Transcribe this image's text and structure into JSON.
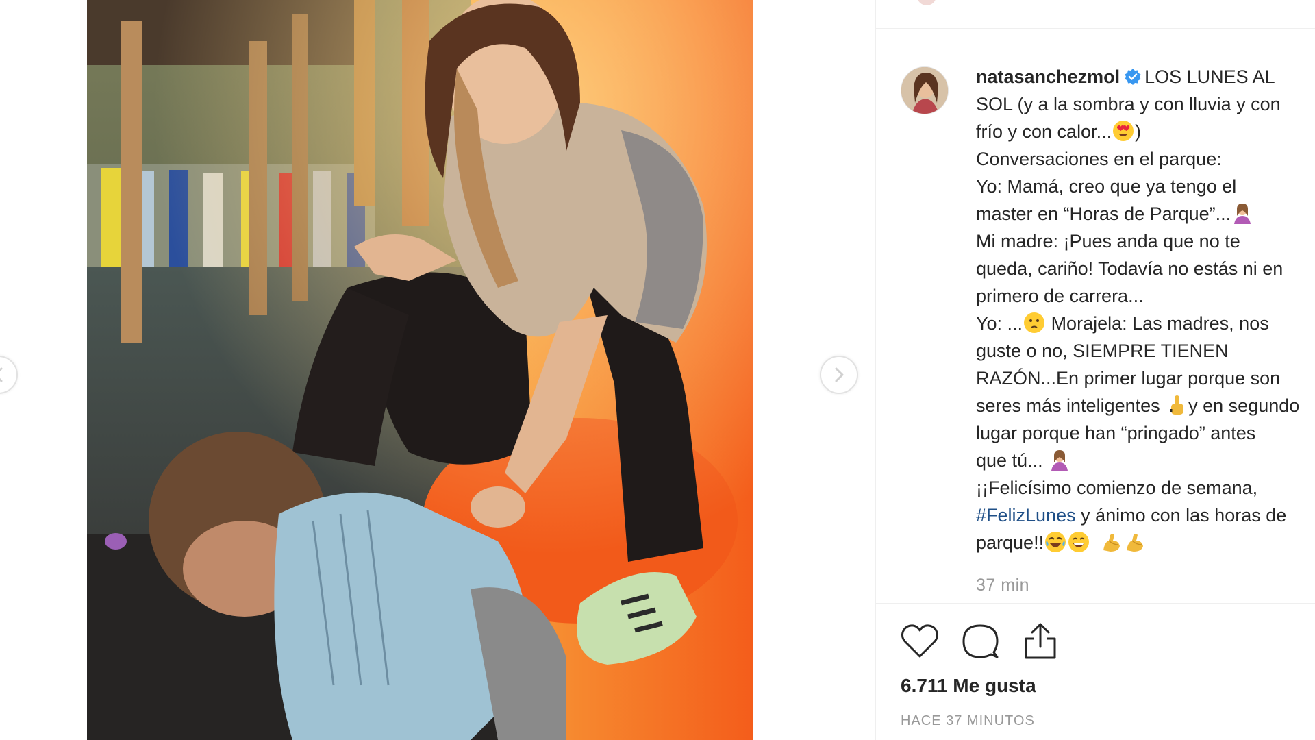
{
  "post": {
    "username": "natasanchezmol",
    "caption_lines": [
      "LOS LUNES AL",
      "SOL (y a la sombra y con lluvia y con",
      "frío y con calor...",
      ")",
      "Conversaciones en el parque:",
      "Yo: Mamá, creo que ya tengo el",
      "master en “Horas de Parque”...",
      "Mi madre: ¡Pues anda que no te",
      "queda, cariño! Todavía no estás ni en",
      "primero de carrera...",
      "Yo: ...",
      " Morajela: Las madres, nos",
      "guste o no, SIEMPRE TIENEN",
      "RAZÓN...En primer lugar porque son",
      "seres más inteligentes ",
      "y en segundo",
      "lugar porque han “pringado” antes",
      "que tú... ",
      "¡¡Felicísimo comienzo de semana,",
      "#FelizLunes",
      " y ánimo con las horas de",
      "parque!!"
    ],
    "caption_time": "37 min",
    "likes": "6.711 Me gusta",
    "timestamp": "HACE 37 MINUTOS"
  },
  "icons": {
    "verified": "verified-badge-icon",
    "like": "heart-icon",
    "comment": "comment-icon",
    "share": "share-icon",
    "prev": "chevron-left-icon",
    "next": "chevron-right-icon"
  },
  "colors": {
    "text": "#262626",
    "muted": "#999999",
    "hashtag": "#1f4f87",
    "verified": "#3897f0"
  }
}
